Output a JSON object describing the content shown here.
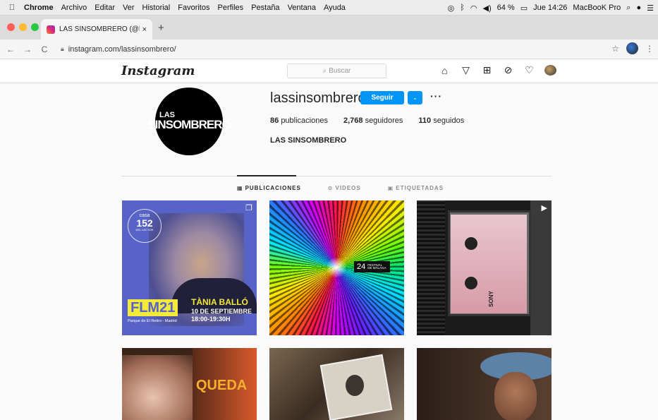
{
  "menubar": {
    "app": "Chrome",
    "items": [
      "Archivo",
      "Editar",
      "Ver",
      "Historial",
      "Favoritos",
      "Perfiles",
      "Pestaña",
      "Ventana",
      "Ayuda"
    ],
    "battery": "64 %",
    "clock": "Jue 14:26",
    "machine": "MacBooK Pro"
  },
  "browser": {
    "tab_title": "LAS SINSOMBRERO (@lassins",
    "tab_close": "×",
    "new_tab": "+",
    "url": "instagram.com/lassinsombrero/"
  },
  "ig": {
    "logo": "Instagram",
    "search_placeholder": "Buscar"
  },
  "profile": {
    "avatar_line1": "LAS",
    "avatar_line2": "SINSOMBRERO",
    "username": "lassinsombrero",
    "follow_label": "Seguir",
    "more": "···",
    "posts_count": "86",
    "posts_label": "publicaciones",
    "followers_count": "2,768",
    "followers_label": "seguidores",
    "following_count": "110",
    "following_label": "seguidos",
    "full_name": "LAS SINSOMBRERO"
  },
  "tabs": {
    "posts": "PUBLICACIONES",
    "videos": "VIDEOS",
    "tagged": "ETIQUETADAS"
  },
  "posts": {
    "p1": {
      "badge_top": "casa",
      "badge_num": "152",
      "badge_sub": "DEL LECTOR",
      "event": "FLM21",
      "name": "TÀNIA BALLÓ",
      "date": "10 DE SEPTIEMBRE",
      "place": "Parque de El Retiro - Madrid",
      "time": "18:00-19:30H"
    },
    "p2": {
      "number": "24",
      "festival": "FESTIVAL DE MÁLAGA"
    },
    "p3": {
      "brand": "SONY"
    },
    "p4": {
      "word": "QUEDA"
    }
  },
  "colors": {
    "accent": "#0095f6",
    "flm_yellow": "#f2e93b",
    "flm_purple": "#5763c6"
  }
}
